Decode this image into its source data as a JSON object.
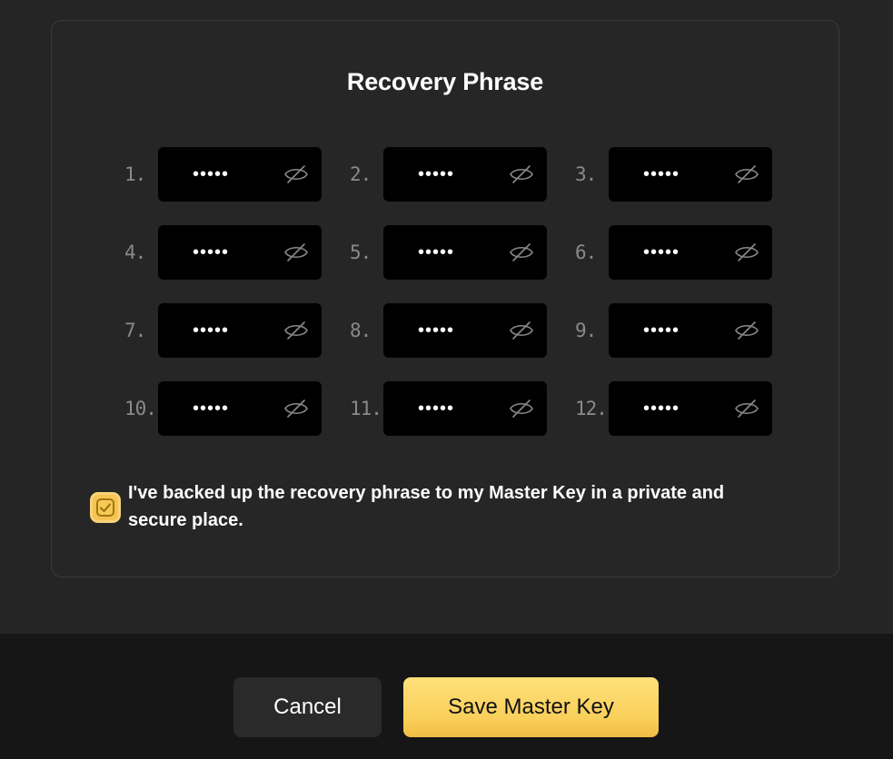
{
  "card": {
    "title": "Recovery Phrase"
  },
  "words": [
    {
      "num": "1.",
      "masked": "•••••"
    },
    {
      "num": "2.",
      "masked": "•••••"
    },
    {
      "num": "3.",
      "masked": "•••••"
    },
    {
      "num": "4.",
      "masked": "•••••"
    },
    {
      "num": "5.",
      "masked": "•••••"
    },
    {
      "num": "6.",
      "masked": "•••••"
    },
    {
      "num": "7.",
      "masked": "•••••"
    },
    {
      "num": "8.",
      "masked": "•••••"
    },
    {
      "num": "9.",
      "masked": "•••••"
    },
    {
      "num": "10.",
      "masked": "•••••"
    },
    {
      "num": "11.",
      "masked": "•••••"
    },
    {
      "num": "12.",
      "masked": "•••••"
    }
  ],
  "word_icon": "eye-slash-icon",
  "acknowledgement": {
    "checked": true,
    "text": "I've backed up the recovery phrase to my Master Key in a private and secure place."
  },
  "footer": {
    "cancel_label": "Cancel",
    "save_label": "Save Master Key"
  },
  "colors": {
    "accent": "#f9cf5a",
    "background": "#252525",
    "footer": "#161616"
  }
}
